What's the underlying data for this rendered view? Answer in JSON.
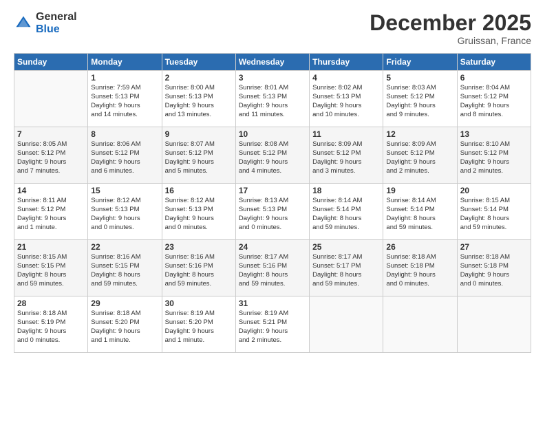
{
  "logo": {
    "general": "General",
    "blue": "Blue"
  },
  "header": {
    "month": "December 2025",
    "location": "Gruissan, France"
  },
  "weekdays": [
    "Sunday",
    "Monday",
    "Tuesday",
    "Wednesday",
    "Thursday",
    "Friday",
    "Saturday"
  ],
  "weeks": [
    [
      {
        "day": "",
        "info": ""
      },
      {
        "day": "1",
        "info": "Sunrise: 7:59 AM\nSunset: 5:13 PM\nDaylight: 9 hours\nand 14 minutes."
      },
      {
        "day": "2",
        "info": "Sunrise: 8:00 AM\nSunset: 5:13 PM\nDaylight: 9 hours\nand 13 minutes."
      },
      {
        "day": "3",
        "info": "Sunrise: 8:01 AM\nSunset: 5:13 PM\nDaylight: 9 hours\nand 11 minutes."
      },
      {
        "day": "4",
        "info": "Sunrise: 8:02 AM\nSunset: 5:13 PM\nDaylight: 9 hours\nand 10 minutes."
      },
      {
        "day": "5",
        "info": "Sunrise: 8:03 AM\nSunset: 5:12 PM\nDaylight: 9 hours\nand 9 minutes."
      },
      {
        "day": "6",
        "info": "Sunrise: 8:04 AM\nSunset: 5:12 PM\nDaylight: 9 hours\nand 8 minutes."
      }
    ],
    [
      {
        "day": "7",
        "info": "Sunrise: 8:05 AM\nSunset: 5:12 PM\nDaylight: 9 hours\nand 7 minutes."
      },
      {
        "day": "8",
        "info": "Sunrise: 8:06 AM\nSunset: 5:12 PM\nDaylight: 9 hours\nand 6 minutes."
      },
      {
        "day": "9",
        "info": "Sunrise: 8:07 AM\nSunset: 5:12 PM\nDaylight: 9 hours\nand 5 minutes."
      },
      {
        "day": "10",
        "info": "Sunrise: 8:08 AM\nSunset: 5:12 PM\nDaylight: 9 hours\nand 4 minutes."
      },
      {
        "day": "11",
        "info": "Sunrise: 8:09 AM\nSunset: 5:12 PM\nDaylight: 9 hours\nand 3 minutes."
      },
      {
        "day": "12",
        "info": "Sunrise: 8:09 AM\nSunset: 5:12 PM\nDaylight: 9 hours\nand 2 minutes."
      },
      {
        "day": "13",
        "info": "Sunrise: 8:10 AM\nSunset: 5:12 PM\nDaylight: 9 hours\nand 2 minutes."
      }
    ],
    [
      {
        "day": "14",
        "info": "Sunrise: 8:11 AM\nSunset: 5:12 PM\nDaylight: 9 hours\nand 1 minute."
      },
      {
        "day": "15",
        "info": "Sunrise: 8:12 AM\nSunset: 5:13 PM\nDaylight: 9 hours\nand 0 minutes."
      },
      {
        "day": "16",
        "info": "Sunrise: 8:12 AM\nSunset: 5:13 PM\nDaylight: 9 hours\nand 0 minutes."
      },
      {
        "day": "17",
        "info": "Sunrise: 8:13 AM\nSunset: 5:13 PM\nDaylight: 9 hours\nand 0 minutes."
      },
      {
        "day": "18",
        "info": "Sunrise: 8:14 AM\nSunset: 5:14 PM\nDaylight: 8 hours\nand 59 minutes."
      },
      {
        "day": "19",
        "info": "Sunrise: 8:14 AM\nSunset: 5:14 PM\nDaylight: 8 hours\nand 59 minutes."
      },
      {
        "day": "20",
        "info": "Sunrise: 8:15 AM\nSunset: 5:14 PM\nDaylight: 8 hours\nand 59 minutes."
      }
    ],
    [
      {
        "day": "21",
        "info": "Sunrise: 8:15 AM\nSunset: 5:15 PM\nDaylight: 8 hours\nand 59 minutes."
      },
      {
        "day": "22",
        "info": "Sunrise: 8:16 AM\nSunset: 5:15 PM\nDaylight: 8 hours\nand 59 minutes."
      },
      {
        "day": "23",
        "info": "Sunrise: 8:16 AM\nSunset: 5:16 PM\nDaylight: 8 hours\nand 59 minutes."
      },
      {
        "day": "24",
        "info": "Sunrise: 8:17 AM\nSunset: 5:16 PM\nDaylight: 8 hours\nand 59 minutes."
      },
      {
        "day": "25",
        "info": "Sunrise: 8:17 AM\nSunset: 5:17 PM\nDaylight: 8 hours\nand 59 minutes."
      },
      {
        "day": "26",
        "info": "Sunrise: 8:18 AM\nSunset: 5:18 PM\nDaylight: 9 hours\nand 0 minutes."
      },
      {
        "day": "27",
        "info": "Sunrise: 8:18 AM\nSunset: 5:18 PM\nDaylight: 9 hours\nand 0 minutes."
      }
    ],
    [
      {
        "day": "28",
        "info": "Sunrise: 8:18 AM\nSunset: 5:19 PM\nDaylight: 9 hours\nand 0 minutes."
      },
      {
        "day": "29",
        "info": "Sunrise: 8:18 AM\nSunset: 5:20 PM\nDaylight: 9 hours\nand 1 minute."
      },
      {
        "day": "30",
        "info": "Sunrise: 8:19 AM\nSunset: 5:20 PM\nDaylight: 9 hours\nand 1 minute."
      },
      {
        "day": "31",
        "info": "Sunrise: 8:19 AM\nSunset: 5:21 PM\nDaylight: 9 hours\nand 2 minutes."
      },
      {
        "day": "",
        "info": ""
      },
      {
        "day": "",
        "info": ""
      },
      {
        "day": "",
        "info": ""
      }
    ]
  ]
}
